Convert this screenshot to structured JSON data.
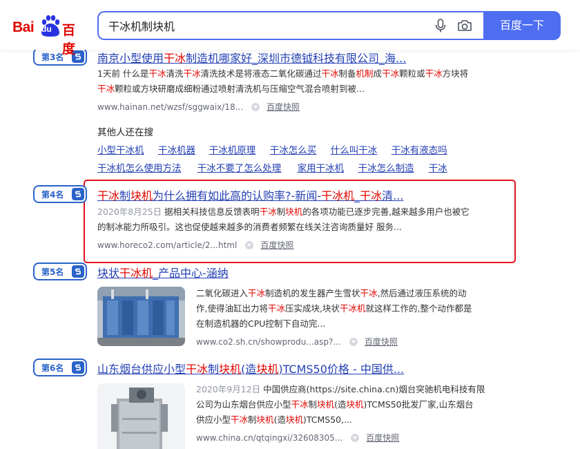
{
  "header": {
    "logo_text_bai": "Bai",
    "logo_text_du": "du",
    "logo_text_cn": "百度",
    "search_value": "干冰机制块机",
    "search_button": "百度一下"
  },
  "results": [
    {
      "rank": "第3名",
      "title_parts": [
        "南京小型使用",
        "干冰",
        "制造机哪家好_深圳市德钺科技有限公司_海..."
      ],
      "snippet_lines": [
        [
          "1天前 什么是",
          "干冰",
          "清洗",
          "干冰",
          "清洗技术是将液态二氧化碳通过",
          "干冰",
          "制备",
          "机制",
          "成",
          "干冰",
          "颗粒或",
          "干冰",
          "方块将"
        ],
        [
          "",
          "干冰",
          "颗粒或方块研磨成细粉通过喷射清洗机与压缩空气混合喷射到被..."
        ]
      ],
      "url": "www.hainan.net/wzsf/sggwaix/18...",
      "cache": "百度快照"
    },
    {
      "rank": "第4名",
      "title_parts": [
        "",
        "干冰",
        "制",
        "块机",
        "为什么拥有如此高的认购率?-新闻-",
        "干冰机",
        "_",
        "干冰",
        "清..."
      ],
      "date": "2020年8月25日",
      "snippet_lines": [
        [
          "据相关科技信息反馈表明",
          "干冰",
          "制",
          "块机",
          "的各项功能已逐步完善,越来越多用户也被它"
        ],
        [
          "的制冰能力所吸引。这也促使越来越多的消费者频繁在线关注咨询质量好 服务..."
        ]
      ],
      "url": "www.horeco2.com/article/2...html",
      "cache": "百度快照"
    },
    {
      "rank": "第5名",
      "title_parts": [
        "块状",
        "干冰机",
        "_产品中心-涵纳"
      ],
      "snippet_lines": [
        [
          "二氧化碳进入",
          "干冰",
          "制造机的发生器产生雪状",
          "干冰",
          ",然后通过液压系统的动"
        ],
        [
          "作,使得油缸出力将",
          "干冰",
          "压实成块,块状",
          "干冰机",
          "就这样工作的,整个动作都是"
        ],
        [
          "在制造机器的CPU控制下自动完..."
        ]
      ],
      "url": "www.co2.sh.cn/showprodu...asp?...",
      "cache": "百度快照"
    },
    {
      "rank": "第6名",
      "title_parts": [
        "山东烟台供应小型",
        "干冰",
        "制",
        "块机",
        "(造",
        "块机",
        ")TCMS50价格 - 中国供..."
      ],
      "date": "2020年9月12日",
      "snippet_lines": [
        [
          "中国供应商(https://site.china.cn)烟台突驰机电科技有限"
        ],
        [
          "公司为山东烟台供应小型",
          "干冰",
          "制",
          "块机",
          "(造",
          "块机",
          ")TCMS50批发厂家,山东烟台"
        ],
        [
          "供应小型",
          "干冰",
          "制",
          "块机",
          "(造",
          "块机",
          ")TCMS50,..."
        ]
      ],
      "url": "www.china.cn/qtqingxi/32608305...",
      "cache": "百度快照"
    }
  ],
  "others": {
    "title": "其他人还在搜",
    "row1": [
      "小型干冰机",
      "干冰机器",
      "干冰机原理",
      "干冰怎么买",
      "什么叫干冰",
      "干冰有液态吗"
    ],
    "row2": [
      "干冰机怎么使用方法",
      "干冰不要了怎么处理",
      "家用干冰机",
      "干冰怎么制造",
      "干冰"
    ]
  },
  "colors": {
    "accent": "#4e6ef2",
    "link": "#2440b3",
    "highlight": "#e10601",
    "badge": "#2a62c9",
    "annotation_box": "#e3101e"
  }
}
